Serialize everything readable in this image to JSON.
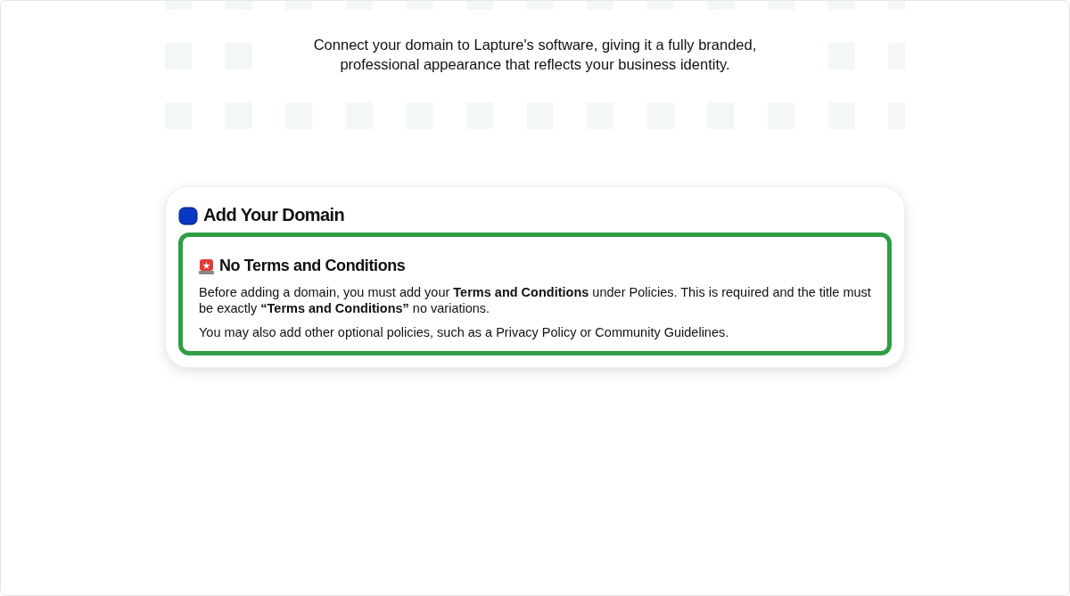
{
  "intro": "Connect your domain to Lapture's software, giving it a fully branded, professional appearance that reflects your business identity.",
  "card": {
    "title": "Add Your Domain",
    "notice": {
      "title": "No Terms and Conditions",
      "paragraphs": [
        "Before adding a domain, you must add your **Terms and Conditions** under Policies. This is required and the title must be exactly **“Terms and Conditions”** no variations.",
        "You may also add other optional policies, such as a Privacy Policy or Community Guidelines."
      ]
    }
  }
}
